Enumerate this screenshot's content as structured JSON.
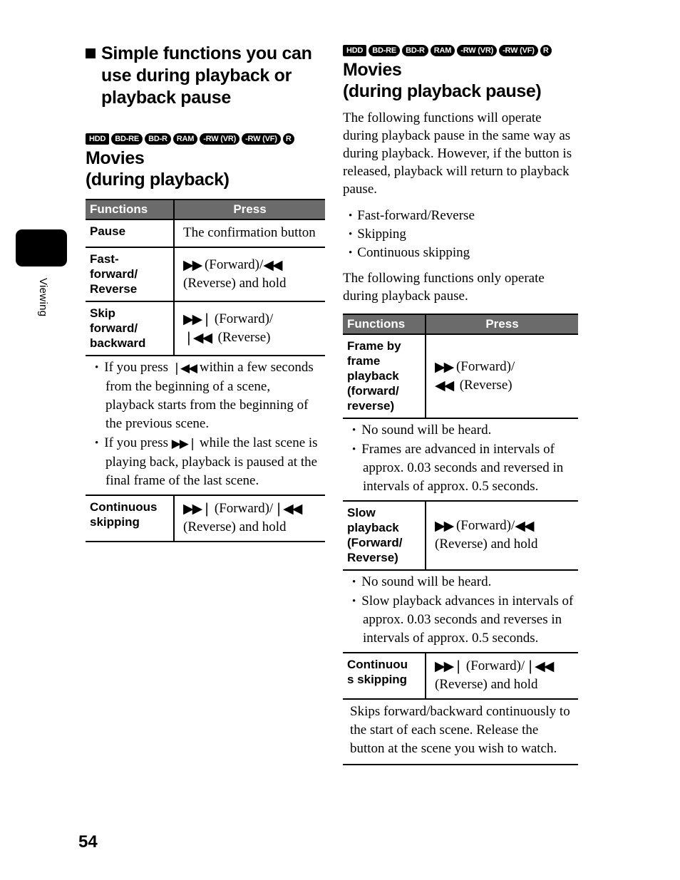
{
  "page": {
    "number": "54",
    "side_tab_label": "Viewing"
  },
  "left_column": {
    "section_heading": "Simple functions you can use during playback or playback pause",
    "media_badges": [
      "HDD",
      "BD-RE",
      "BD-R",
      "RAM",
      "-RW (VR)",
      "-RW (VF)",
      "R"
    ],
    "sub_heading_line1": "Movies",
    "sub_heading_line2": "(during playback)",
    "table": {
      "headers": [
        "Functions",
        "Press"
      ],
      "rows": [
        {
          "function": "Pause",
          "press_lines": [
            "The confirmation button"
          ]
        },
        {
          "function": "Fast-forward/ Reverse",
          "press_lines": [
            "▶▶ (Forward)/◀◀",
            "(Reverse) and hold"
          ]
        },
        {
          "function": "Skip forward/ backward",
          "press_lines": [
            "▶▶| (Forward)/",
            "|◀◀  (Reverse)"
          ]
        }
      ],
      "notes": [
        "If you press |◀◀ within a few seconds from the beginning of a scene, playback starts from the beginning of the previous scene.",
        "If you press ▶▶| while the last scene is playing back, playback is paused at the final frame of the last scene."
      ],
      "last_row": {
        "function": "Continuous skipping",
        "press_lines": [
          "▶▶| (Forward)/|◀◀",
          "(Reverse) and hold"
        ]
      }
    }
  },
  "right_column": {
    "media_badges": [
      "HDD",
      "BD-RE",
      "BD-R",
      "RAM",
      "-RW (VR)",
      "-RW (VF)",
      "R"
    ],
    "sub_heading_line1": "Movies",
    "sub_heading_line2": "(during playback pause)",
    "intro_paragraph": "The following functions will operate during playback pause in the same way as during playback. However, if the button is released, playback will return to playback pause.",
    "bullet_list": [
      "Fast-forward/Reverse",
      "Skipping",
      "Continuous skipping"
    ],
    "second_paragraph": "The following functions only operate during playback pause.",
    "table": {
      "headers": [
        "Functions",
        "Press"
      ],
      "row1": {
        "function": "Frame by frame playback (forward/ reverse)",
        "press_lines": [
          "▶▶ (Forward)/",
          "◀◀  (Reverse)"
        ]
      },
      "notes1": [
        "No sound will be heard.",
        "Frames are advanced in intervals of approx. 0.03 seconds and reversed in intervals of approx. 0.5 seconds."
      ],
      "row2": {
        "function": "Slow playback (Forward/ Reverse)",
        "press_lines": [
          "▶▶ (Forward)/◀◀",
          "(Reverse) and hold"
        ]
      },
      "notes2": [
        "No sound will be heard.",
        "Slow playback advances in intervals of approx. 0.03 seconds and reverses in intervals of approx. 0.5 seconds."
      ],
      "row3": {
        "function": "Continuou s skipping",
        "press_lines": [
          "▶▶| (Forward)/|◀◀",
          "(Reverse) and hold"
        ]
      },
      "notes3_paragraph": "Skips forward/backward continuously to the start of each scene. Release the button at the scene you wish to watch."
    }
  }
}
